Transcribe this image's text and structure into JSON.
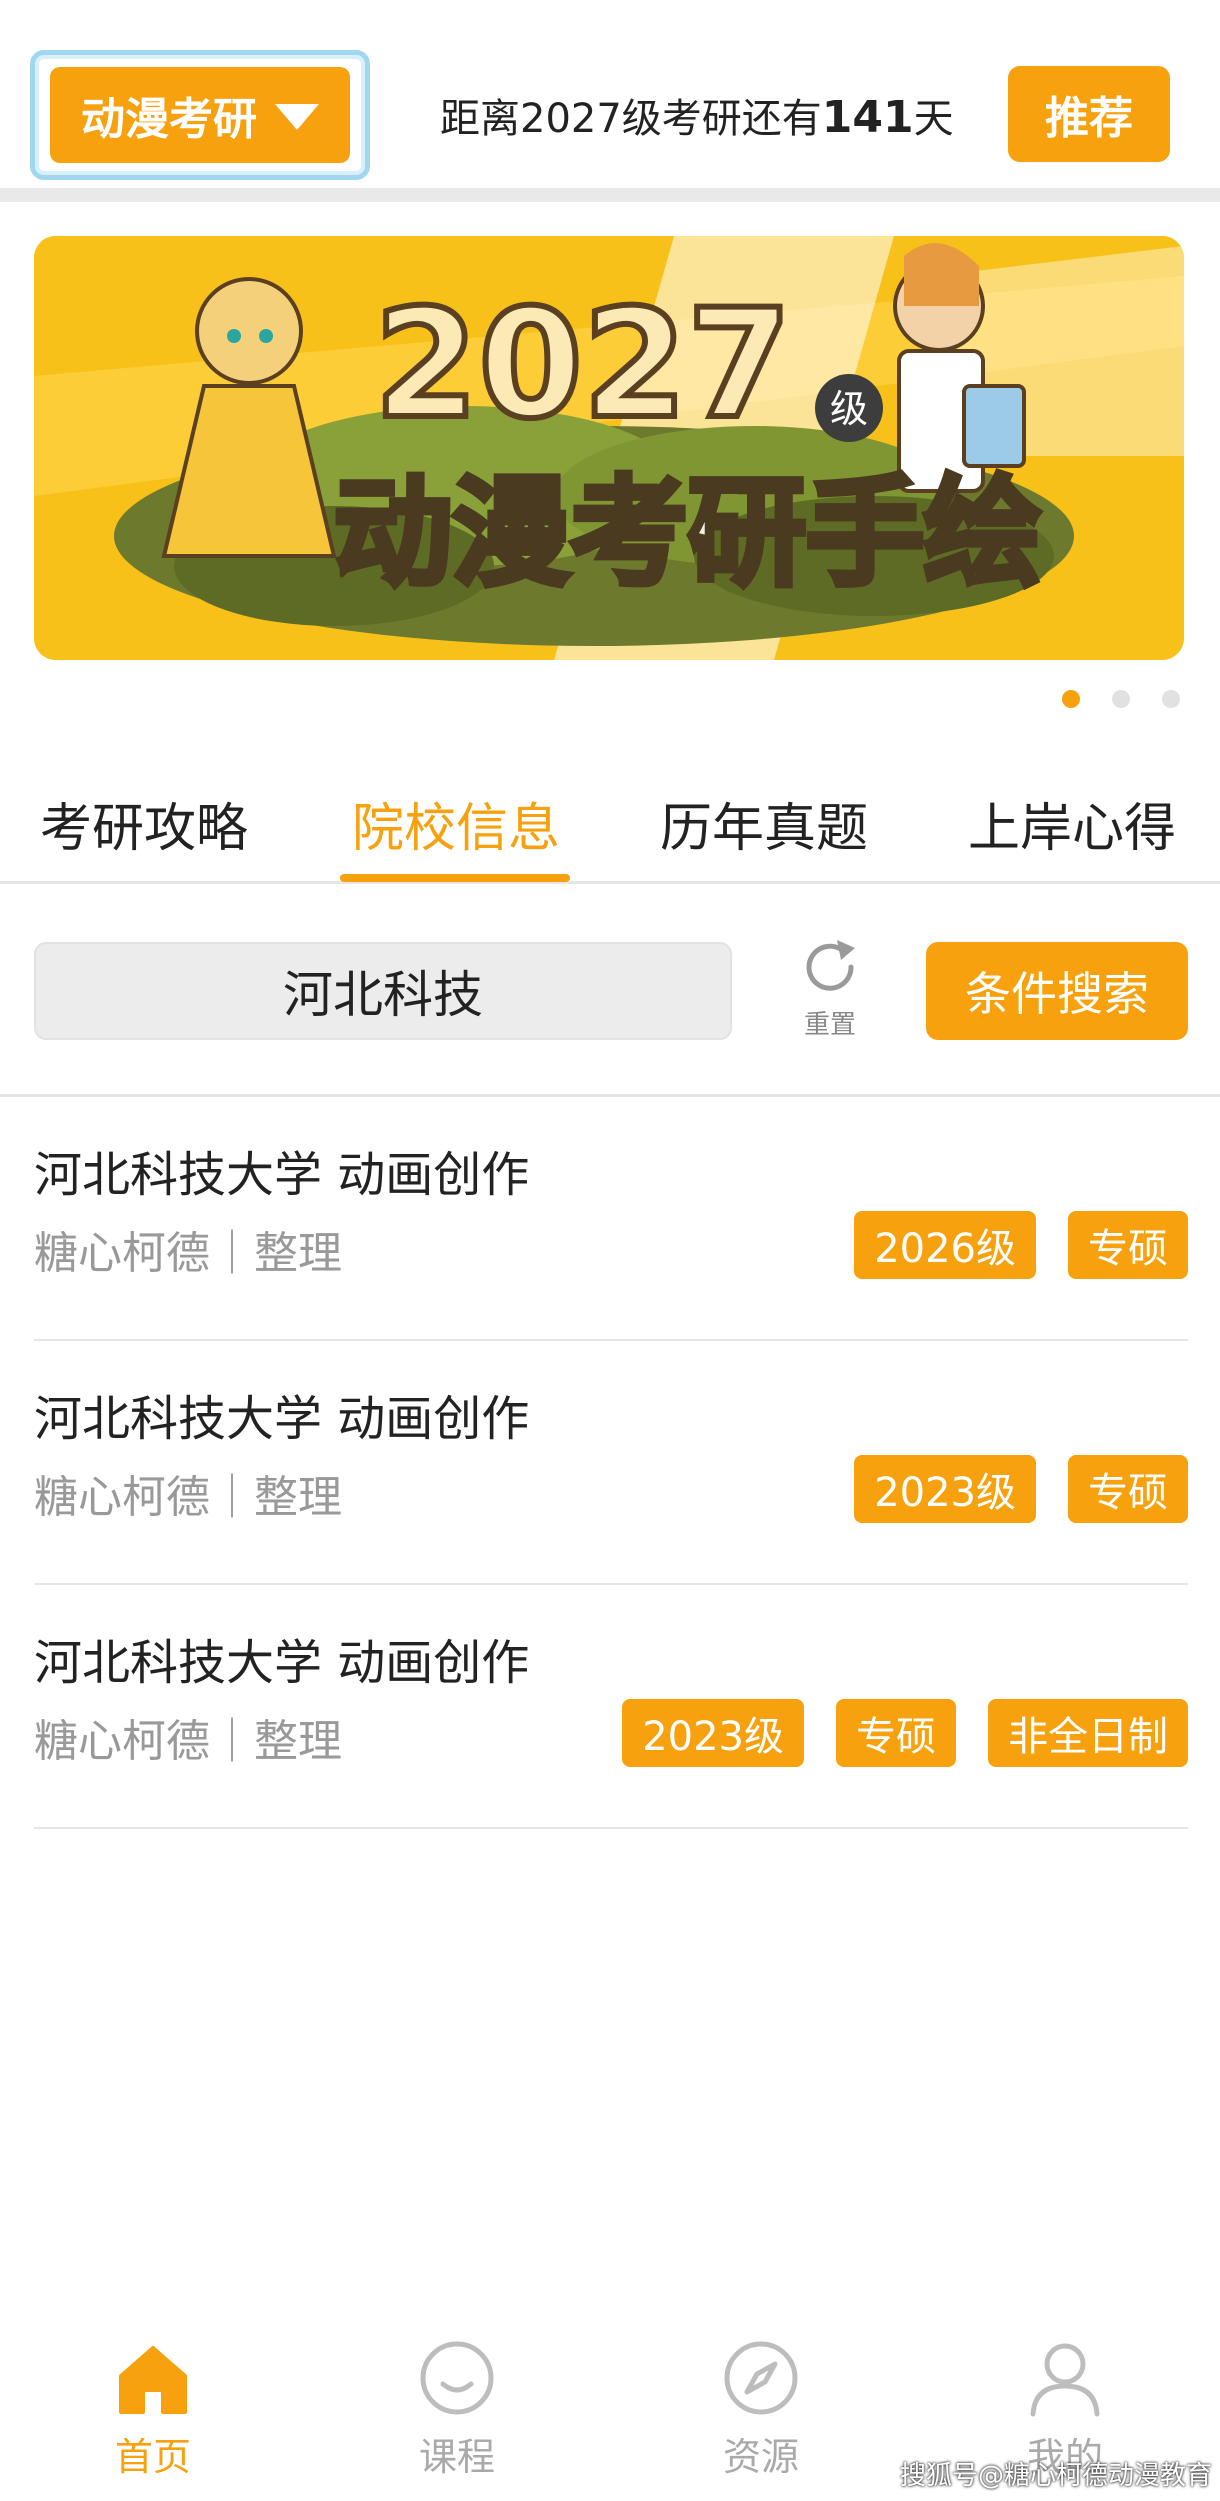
{
  "header": {
    "selector_label": "动漫考研",
    "countdown_prefix": "距离2027级考研还有",
    "countdown_days": "141",
    "countdown_suffix": "天",
    "recommend_label": "推荐"
  },
  "banner": {
    "year_text": "2027",
    "grade_text": "级",
    "title_text": "动漫考研手绘",
    "slides_total": 3,
    "active_slide": 1
  },
  "tabs": [
    {
      "label": "考研攻略",
      "active": false
    },
    {
      "label": "院校信息",
      "active": true
    },
    {
      "label": "历年真题",
      "active": false
    },
    {
      "label": "上岸心得",
      "active": false
    }
  ],
  "search": {
    "value": "河北科技",
    "reset_label": "重置",
    "button_label": "条件搜索"
  },
  "items": [
    {
      "title": "河北科技大学  动画创作",
      "subtitle": "糖心柯德｜整理",
      "tags": [
        "2026级",
        "专硕"
      ]
    },
    {
      "title": "河北科技大学  动画创作",
      "subtitle": "糖心柯德｜整理",
      "tags": [
        "2023级",
        "专硕"
      ]
    },
    {
      "title": "河北科技大学  动画创作",
      "subtitle": "糖心柯德｜整理",
      "tags": [
        "2023级",
        "专硕",
        "非全日制"
      ]
    }
  ],
  "nav": [
    {
      "label": "首页",
      "icon": "home-icon",
      "active": true
    },
    {
      "label": "课程",
      "icon": "smile-icon",
      "active": false
    },
    {
      "label": "资源",
      "icon": "compass-icon",
      "active": false
    },
    {
      "label": "我的",
      "icon": "user-icon",
      "active": false
    }
  ],
  "watermark": "搜狐号@糖心柯德动漫教育",
  "colors": {
    "accent": "#f7a10f",
    "banner_bg": "#f7c11a",
    "muted": "#999999"
  }
}
